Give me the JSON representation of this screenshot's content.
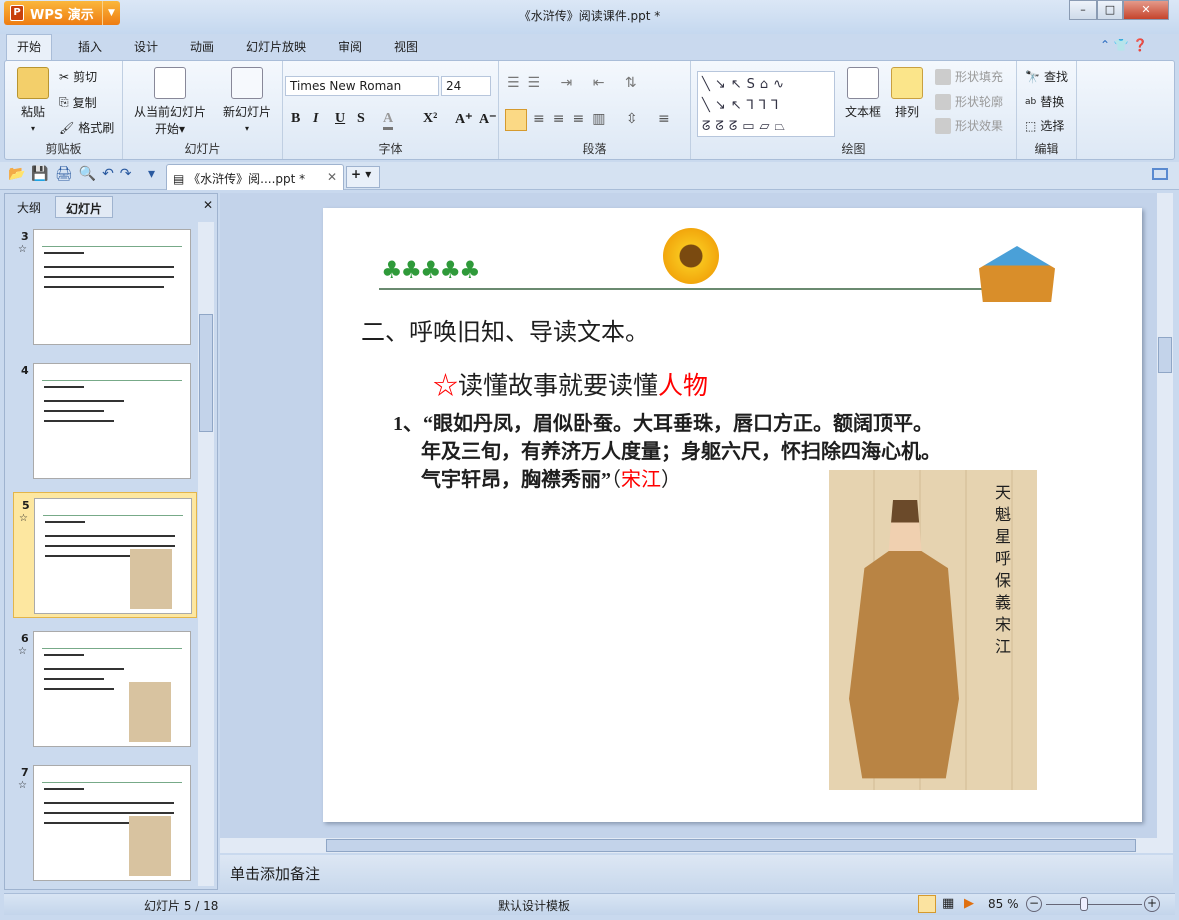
{
  "app": {
    "name": "WPS 演示",
    "title": "《水浒传》阅读课件.ppt *"
  },
  "window": {
    "minimize": "–",
    "maximize": "□",
    "close": "✕"
  },
  "tabs": [
    "开始",
    "插入",
    "设计",
    "动画",
    "幻灯片放映",
    "审阅",
    "视图"
  ],
  "ribbon": {
    "clipboard": {
      "paste": "粘贴",
      "cut": "剪切",
      "copy": "复制",
      "format_painter": "格式刷",
      "label": "剪贴板"
    },
    "slides": {
      "from_current": "从当前幻灯片",
      "start": "开始",
      "new_slide": "新幻灯片",
      "label": "幻灯片"
    },
    "font": {
      "name": "Times New Roman",
      "size": "24",
      "bold": "B",
      "italic": "I",
      "underline": "U",
      "shadow": "S",
      "color": "A",
      "superscript": "X²",
      "grow": "A⁺",
      "shrink": "A⁻",
      "label": "字体"
    },
    "paragraph": {
      "label": "段落"
    },
    "drawing": {
      "text_box": "文本框",
      "arrange": "排列",
      "shape_fill": "形状填充",
      "shape_outline": "形状轮廓",
      "shape_effect": "形状效果",
      "label": "绘图"
    },
    "editing": {
      "find": "查找",
      "replace": "替换",
      "select": "选择",
      "label": "编辑"
    }
  },
  "doc_tab": {
    "label": "《水浒传》阅....ppt *"
  },
  "left_pane": {
    "tabs": [
      "大纲",
      "幻灯片"
    ],
    "close": "✕",
    "thumbnails": [
      {
        "num": "3",
        "star": "☆",
        "selected": false
      },
      {
        "num": "4",
        "star": "",
        "selected": false
      },
      {
        "num": "5",
        "star": "☆",
        "selected": true
      },
      {
        "num": "6",
        "star": "☆",
        "selected": false
      },
      {
        "num": "7",
        "star": "☆",
        "selected": false
      }
    ]
  },
  "slide": {
    "heading": "二、呼唤旧知、导读文本。",
    "star": "☆",
    "subheading": "读懂故事就要读懂",
    "subheading_red": "人物",
    "item_num": "1、",
    "quote_lines": [
      "“眼如丹凤，眉似卧蚕。大耳垂珠，唇口方正。额阔顶平。",
      "年及三旬，有养济万人度量；身躯六尺，怀扫除四海心机。",
      "气宇轩昂，胸襟秀丽”"
    ],
    "attribution_open": "（",
    "attribution": "宋江",
    "attribution_close": "）",
    "image_inscription": "天魁星呼保義宋江"
  },
  "notes": {
    "placeholder": "单击添加备注"
  },
  "status": {
    "slide": "幻灯片 5 / 18",
    "template": "默认设计模板",
    "zoom": "85 %",
    "zoom_level": 85
  },
  "colors": {
    "accent_red": "#ff0000",
    "selected_thumb": "#fde7a0"
  }
}
